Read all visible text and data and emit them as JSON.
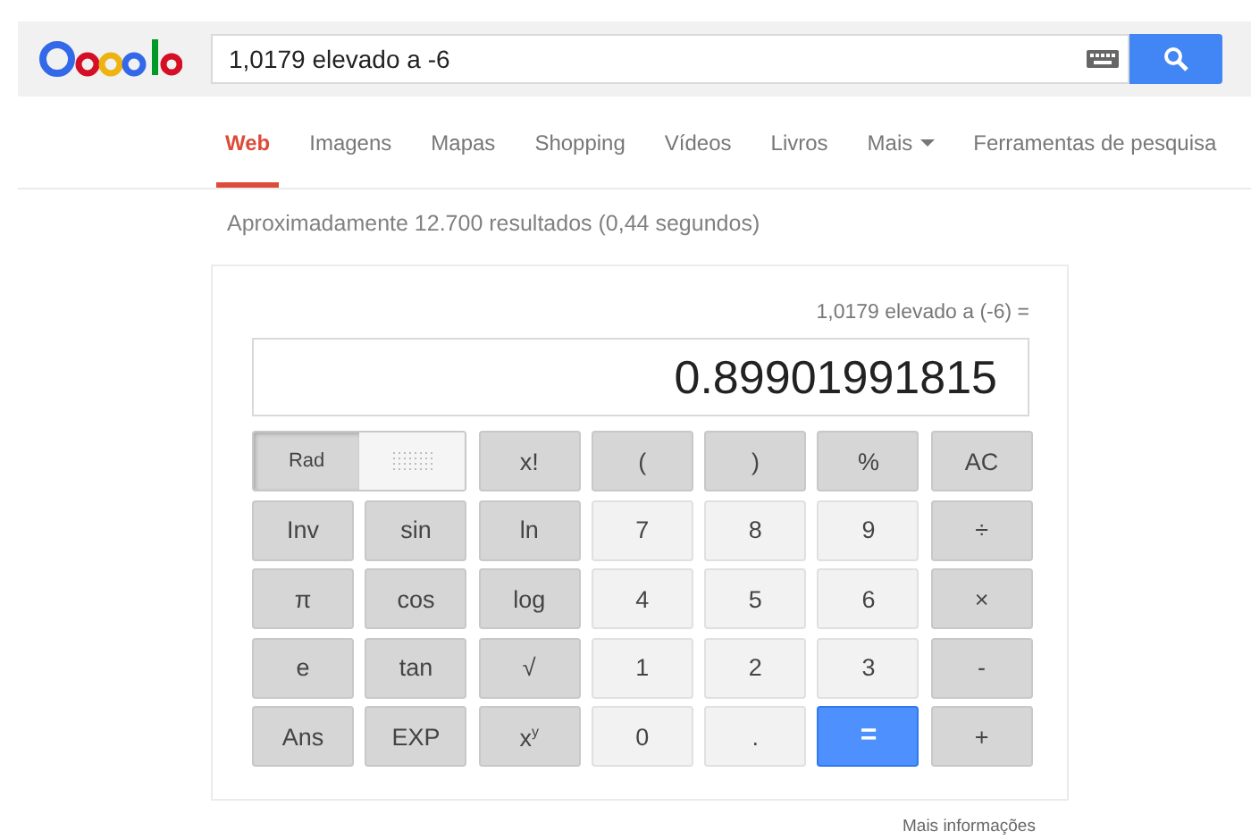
{
  "search": {
    "value": "1,0179 elevado a -6"
  },
  "tabs": [
    {
      "label": "Web",
      "selected": true
    },
    {
      "label": "Imagens",
      "selected": false
    },
    {
      "label": "Mapas",
      "selected": false
    },
    {
      "label": "Shopping",
      "selected": false
    },
    {
      "label": "Vídeos",
      "selected": false
    },
    {
      "label": "Livros",
      "selected": false
    },
    {
      "label": "Mais",
      "selected": false,
      "kind": "dropdown"
    },
    {
      "label": "Ferramentas de pesquisa",
      "selected": false
    }
  ],
  "result_stats": "Aproximadamente 12.700 resultados (0,44 segundos)",
  "calculator": {
    "expression": "1,0179 elevado a (-6) =",
    "display": "0.89901991815",
    "angle_toggle": {
      "label": "Rad",
      "selected": true
    },
    "keys": [
      [
        {
          "label": "x!",
          "kind": "func"
        },
        {
          "label": "(",
          "kind": "func"
        },
        {
          "label": ")",
          "kind": "func"
        },
        {
          "label": "%",
          "kind": "func"
        },
        {
          "label": "AC",
          "kind": "func"
        }
      ],
      [
        {
          "label": "Inv",
          "kind": "func"
        },
        {
          "label": "sin",
          "kind": "func"
        },
        {
          "label": "ln",
          "kind": "func"
        },
        {
          "label": "7",
          "kind": "num"
        },
        {
          "label": "8",
          "kind": "num"
        },
        {
          "label": "9",
          "kind": "num"
        },
        {
          "label": "÷",
          "kind": "func"
        }
      ],
      [
        {
          "label": "π",
          "kind": "func"
        },
        {
          "label": "cos",
          "kind": "func"
        },
        {
          "label": "log",
          "kind": "func"
        },
        {
          "label": "4",
          "kind": "num"
        },
        {
          "label": "5",
          "kind": "num"
        },
        {
          "label": "6",
          "kind": "num"
        },
        {
          "label": "×",
          "kind": "func"
        }
      ],
      [
        {
          "label": "e",
          "kind": "func"
        },
        {
          "label": "tan",
          "kind": "func"
        },
        {
          "label": "√",
          "kind": "func"
        },
        {
          "label": "1",
          "kind": "num"
        },
        {
          "label": "2",
          "kind": "num"
        },
        {
          "label": "3",
          "kind": "num"
        },
        {
          "label": "-",
          "kind": "func"
        }
      ],
      [
        {
          "label": "Ans",
          "kind": "func"
        },
        {
          "label": "EXP",
          "kind": "func"
        },
        {
          "label": "x$^{y}$",
          "kind": "func"
        },
        {
          "label": "0",
          "kind": "num"
        },
        {
          "label": ".",
          "kind": "num"
        },
        {
          "label": "=",
          "kind": "equals"
        },
        {
          "label": "+",
          "kind": "func"
        }
      ]
    ]
  },
  "more_info": "Mais informações"
}
